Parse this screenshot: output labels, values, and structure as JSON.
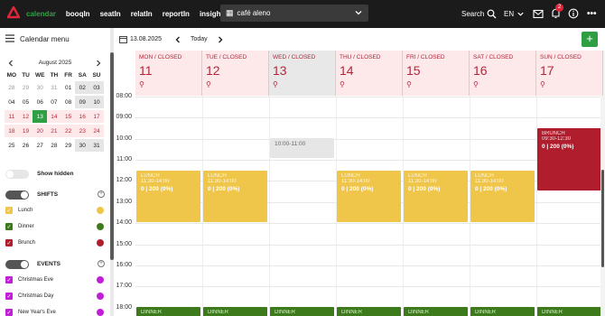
{
  "topbar": {
    "nav": [
      "calendar",
      "booqIn",
      "seatIn",
      "relatIn",
      "reportIn",
      "insights"
    ],
    "venue": "café aleno",
    "search": "Search",
    "lang": "EN",
    "notif_count": "2"
  },
  "sidebar": {
    "title": "Calendar menu",
    "month": "August 2025",
    "weekdays": [
      "MO",
      "TU",
      "WE",
      "TH",
      "FR",
      "SA",
      "SU"
    ],
    "weeks": [
      [
        "28",
        "29",
        "30",
        "31",
        "01",
        "02",
        "03"
      ],
      [
        "04",
        "05",
        "06",
        "07",
        "08",
        "09",
        "10"
      ],
      [
        "11",
        "12",
        "13",
        "14",
        "15",
        "16",
        "17"
      ],
      [
        "18",
        "19",
        "20",
        "21",
        "22",
        "23",
        "24"
      ],
      [
        "25",
        "26",
        "27",
        "28",
        "29",
        "30",
        "31"
      ]
    ],
    "show_hidden": "Show hidden",
    "shifts_title": "SHIFTS",
    "shifts": [
      {
        "label": "Lunch",
        "color": "#f0c64a"
      },
      {
        "label": "Dinner",
        "color": "#3d7a1c"
      },
      {
        "label": "Brunch",
        "color": "#b01e2e"
      }
    ],
    "events_title": "EVENTS",
    "events": [
      {
        "label": "Christmas Eve",
        "color": "#c21ed8"
      },
      {
        "label": "Christmas Day",
        "color": "#c21ed8"
      },
      {
        "label": "New Year's Eve",
        "color": "#c21ed8"
      }
    ]
  },
  "toolbar": {
    "date": "13.08.2025",
    "today": "Today"
  },
  "days": [
    {
      "label": "MON / CLOSED",
      "num": "11"
    },
    {
      "label": "TUE / CLOSED",
      "num": "12"
    },
    {
      "label": "WED / CLOSED",
      "num": "13"
    },
    {
      "label": "THU / CLOSED",
      "num": "14"
    },
    {
      "label": "FRI / CLOSED",
      "num": "15"
    },
    {
      "label": "SAT / CLOSED",
      "num": "16"
    },
    {
      "label": "SUN / CLOSED",
      "num": "17"
    }
  ],
  "times": [
    "08:00",
    "09:00",
    "10:00",
    "11:00",
    "12:00",
    "13:00",
    "14:00",
    "15:00",
    "16:00",
    "17:00",
    "18:00"
  ],
  "events": {
    "lunch": {
      "title": "LUNCH",
      "span": "11:30-14:00",
      "count": "0 | 200 (0%)"
    },
    "brunch": {
      "title": "BRUNCH",
      "span": "09:30-12:30",
      "count": "0 | 200 (0%)"
    },
    "slot": {
      "span": "10:00-11:00"
    },
    "dinner": {
      "title": "DINNER"
    }
  }
}
